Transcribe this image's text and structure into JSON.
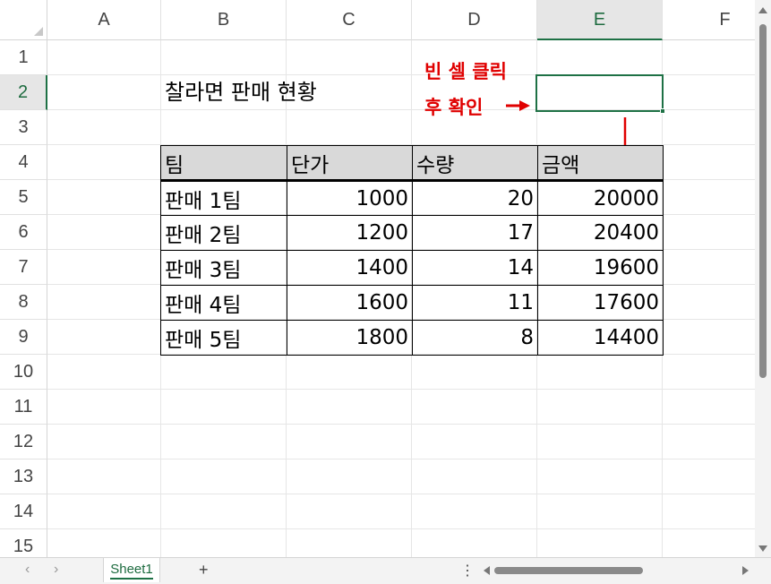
{
  "columns": [
    "A",
    "B",
    "C",
    "D",
    "E",
    "F"
  ],
  "rows": [
    "1",
    "2",
    "3",
    "4",
    "5",
    "6",
    "7",
    "8",
    "9",
    "10",
    "11",
    "12",
    "13",
    "14",
    "15"
  ],
  "selected_column": "E",
  "selected_row": "2",
  "title_cell": "찰라면 판매 현황",
  "note_line1": "빈 셀 클릭",
  "note_line2": "후 확인",
  "table": {
    "headers": [
      "팀",
      "단가",
      "수량",
      "금액"
    ],
    "rows": [
      [
        "판매 1팀",
        "1000",
        "20",
        "20000"
      ],
      [
        "판매 2팀",
        "1200",
        "17",
        "20400"
      ],
      [
        "판매 3팀",
        "1400",
        "14",
        "19600"
      ],
      [
        "판매 4팀",
        "1600",
        "11",
        "17600"
      ],
      [
        "판매 5팀",
        "1800",
        "8",
        "14400"
      ]
    ]
  },
  "sheet_tab": "Sheet1",
  "add_sheet": "+",
  "nav_prev": "‹",
  "nav_next": "›",
  "more_options": "⋮",
  "colors": {
    "accent": "#1e7145",
    "annotation": "#e00000",
    "header_fill": "#d9d9d9"
  }
}
